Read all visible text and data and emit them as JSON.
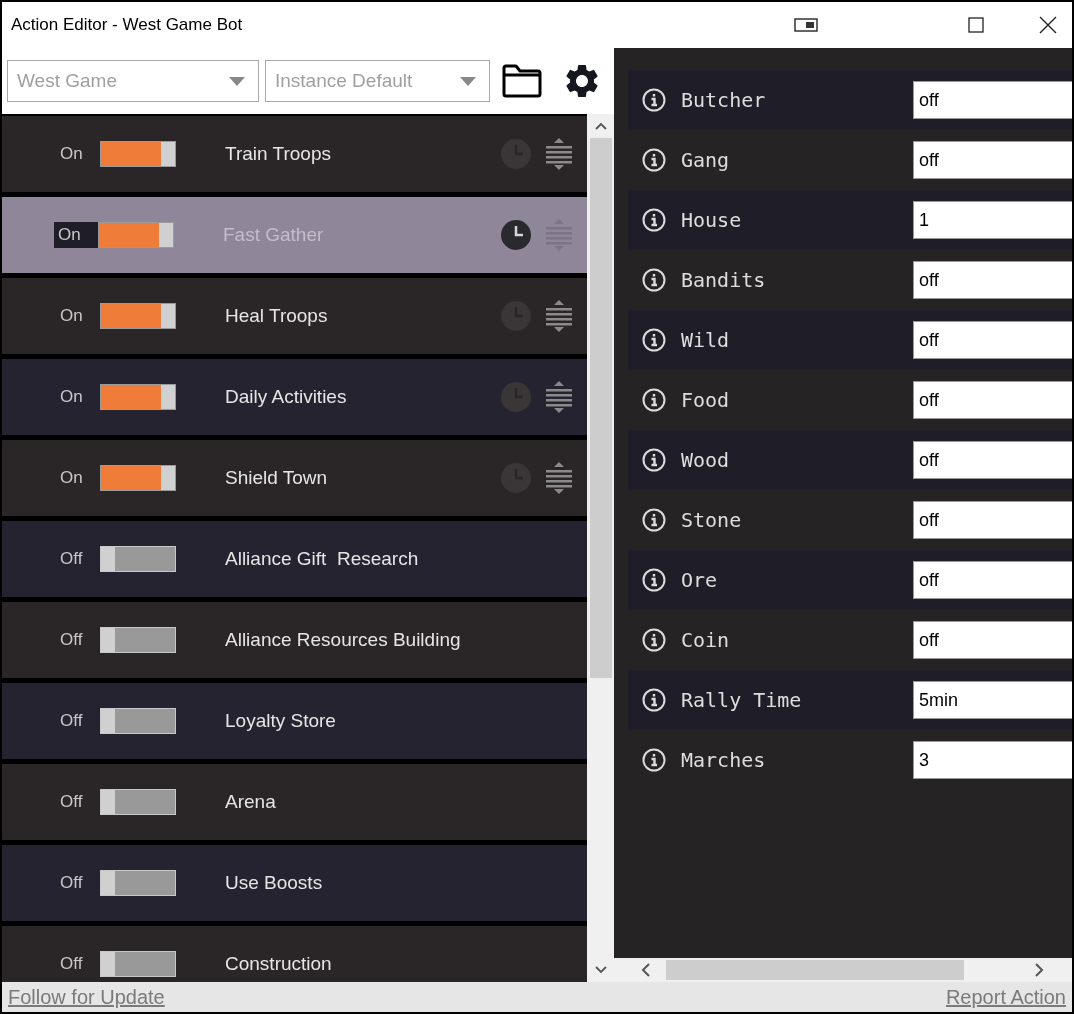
{
  "window": {
    "title": "Action Editor - West Game Bot"
  },
  "toolbar": {
    "game_dropdown": "West Game",
    "instance_dropdown": "Instance Default"
  },
  "actions": [
    {
      "state_label": "On",
      "on": true,
      "name": "Train Troops",
      "selected": false
    },
    {
      "state_label": "On",
      "on": true,
      "name": "Fast Gather",
      "selected": true
    },
    {
      "state_label": "On",
      "on": true,
      "name": "Heal Troops",
      "selected": false
    },
    {
      "state_label": "On",
      "on": true,
      "name": "Daily Activities",
      "selected": false
    },
    {
      "state_label": "On",
      "on": true,
      "name": "Shield Town",
      "selected": false
    },
    {
      "state_label": "Off",
      "on": false,
      "name": "Alliance Gift  Research",
      "selected": false
    },
    {
      "state_label": "Off",
      "on": false,
      "name": "Alliance Resources Building",
      "selected": false
    },
    {
      "state_label": "Off",
      "on": false,
      "name": "Loyalty Store",
      "selected": false
    },
    {
      "state_label": "Off",
      "on": false,
      "name": "Arena",
      "selected": false
    },
    {
      "state_label": "Off",
      "on": false,
      "name": "Use Boosts",
      "selected": false
    },
    {
      "state_label": "Off",
      "on": false,
      "name": "Construction",
      "selected": false
    }
  ],
  "settings": [
    {
      "label": "Butcher",
      "value": "off"
    },
    {
      "label": "Gang",
      "value": "off"
    },
    {
      "label": "House",
      "value": "1"
    },
    {
      "label": "Bandits",
      "value": "off"
    },
    {
      "label": "Wild",
      "value": "off"
    },
    {
      "label": "Food",
      "value": "off"
    },
    {
      "label": "Wood",
      "value": "off"
    },
    {
      "label": "Stone",
      "value": "off"
    },
    {
      "label": "Ore",
      "value": "off"
    },
    {
      "label": "Coin",
      "value": "off"
    },
    {
      "label": "Rally Time",
      "value": "5min"
    },
    {
      "label": "Marches",
      "value": "3"
    }
  ],
  "status_bar": {
    "left_link": "Follow for Update",
    "right_link": "Report Action"
  }
}
